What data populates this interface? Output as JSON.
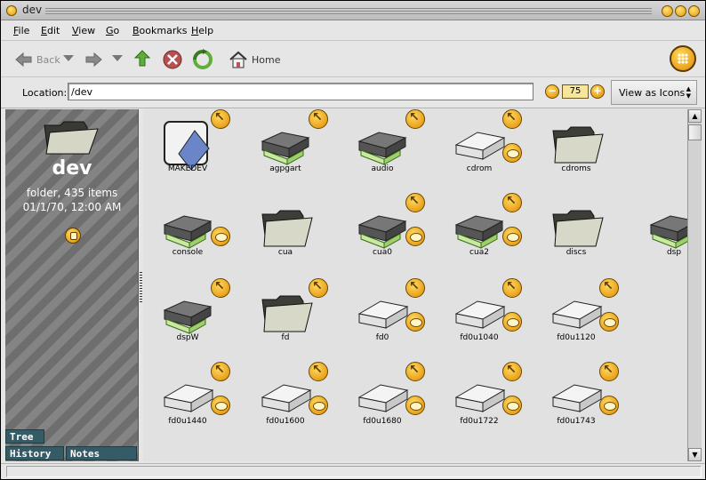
{
  "window": {
    "title": "dev"
  },
  "menu": [
    "File",
    "Edit",
    "View",
    "Go",
    "Bookmarks",
    "Help"
  ],
  "toolbar": {
    "back_label": "Back",
    "home_label": "Home"
  },
  "location": {
    "label": "Location:",
    "value": "/dev",
    "zoom": "75",
    "view_as": "View as Icons"
  },
  "sidebar": {
    "title": "dev",
    "line1": "folder, 435 items",
    "line2": "01/1/70, 12:00 AM",
    "tabs": [
      "Tree",
      "History",
      "Notes"
    ]
  },
  "icons": [
    {
      "label": "MAKEDEV",
      "type": "script",
      "emblems": [
        "arrow"
      ]
    },
    {
      "label": "agpgart",
      "type": "device",
      "emblems": [
        "arrow"
      ]
    },
    {
      "label": "audio",
      "type": "device",
      "emblems": [
        "arrow"
      ]
    },
    {
      "label": "cdrom",
      "type": "drive",
      "emblems": [
        "arrow",
        "disc"
      ]
    },
    {
      "label": "cdroms",
      "type": "folder",
      "emblems": []
    },
    {
      "label": "console",
      "type": "device",
      "emblems": [
        "disc"
      ]
    },
    {
      "label": "cua",
      "type": "folder",
      "emblems": []
    },
    {
      "label": "cua0",
      "type": "device",
      "emblems": [
        "arrow",
        "disc"
      ]
    },
    {
      "label": "cua2",
      "type": "device",
      "emblems": [
        "arrow",
        "disc"
      ]
    },
    {
      "label": "discs",
      "type": "folder",
      "emblems": []
    },
    {
      "label": "dsp",
      "type": "device",
      "emblems": [
        "arrow"
      ]
    },
    {
      "label": "dspW",
      "type": "device",
      "emblems": [
        "arrow"
      ]
    },
    {
      "label": "fd",
      "type": "folder",
      "emblems": [
        "arrow"
      ]
    },
    {
      "label": "fd0",
      "type": "drive",
      "emblems": [
        "arrow",
        "disc"
      ]
    },
    {
      "label": "fd0u1040",
      "type": "drive",
      "emblems": [
        "arrow",
        "disc"
      ]
    },
    {
      "label": "fd0u1120",
      "type": "drive",
      "emblems": [
        "arrow",
        "disc"
      ]
    },
    {
      "label": "fd0u1440",
      "type": "drive",
      "emblems": [
        "arrow",
        "disc"
      ]
    },
    {
      "label": "fd0u1600",
      "type": "drive",
      "emblems": [
        "arrow",
        "disc"
      ]
    },
    {
      "label": "fd0u1680",
      "type": "drive",
      "emblems": [
        "arrow",
        "disc"
      ]
    },
    {
      "label": "fd0u1722",
      "type": "drive",
      "emblems": [
        "arrow",
        "disc"
      ]
    },
    {
      "label": "fd0u1743",
      "type": "drive",
      "emblems": [
        "arrow",
        "disc"
      ]
    }
  ]
}
